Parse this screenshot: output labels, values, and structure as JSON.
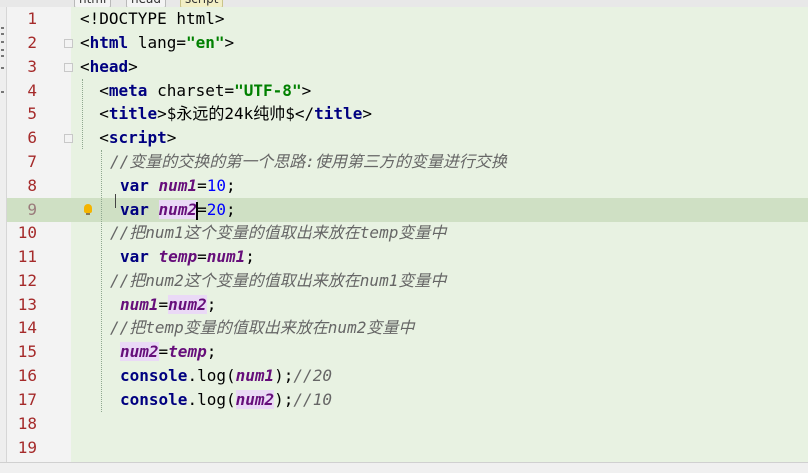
{
  "breadcrumb": [
    "html",
    "head",
    "script"
  ],
  "line_numbers": [
    "1",
    "2",
    "3",
    "4",
    "5",
    "6",
    "7",
    "8",
    "9",
    "10",
    "11",
    "12",
    "13",
    "14",
    "15",
    "16",
    "17",
    "18",
    "19"
  ],
  "current_line": "9",
  "code": {
    "l1": "<!DOCTYPE html>",
    "l2": {
      "open": "<",
      "tag": "html",
      "sp": " ",
      "attr": "lang=",
      "val": "\"en\"",
      "close": ">"
    },
    "l3": {
      "open": "<",
      "tag": "head",
      "close": ">"
    },
    "l4": {
      "indent": "  ",
      "open": "<",
      "tag": "meta",
      "sp": " ",
      "attr": "charset=",
      "val": "\"UTF-8\"",
      "close": ">"
    },
    "l5": {
      "indent": "  ",
      "open": "<",
      "tag": "title",
      "close": ">",
      "text": "$永远的24k纯帅$",
      "open2": "</",
      "tag2": "title",
      "close2": ">"
    },
    "l6": {
      "indent": "  ",
      "open": "<",
      "tag": "script",
      "close": ">"
    },
    "l7": "//变量的交换的第一个思路:使用第三方的变量进行交换",
    "l8": {
      "kw": "var",
      "sp": " ",
      "v": "num1",
      "eq": "=",
      "n": "10",
      "end": ";"
    },
    "l9": {
      "kw": "var",
      "sp": " ",
      "v": "num2",
      "eq": "=",
      "n": "20",
      "end": ";"
    },
    "l10": "//把num1这个变量的值取出来放在temp变量中",
    "l11": {
      "kw": "var",
      "sp": " ",
      "v": "temp",
      "eq": "=",
      "v2": "num1",
      "end": ";"
    },
    "l12": "//把num2这个变量的值取出来放在num1变量中",
    "l13": {
      "v": "num1",
      "eq": "=",
      "v2": "num2",
      "end": ";"
    },
    "l14": "//把temp变量的值取出来放在num2变量中",
    "l15": {
      "v": "num2",
      "eq": "=",
      "v2": "temp",
      "end": ";"
    },
    "l16": {
      "obj": "console",
      "dot": ".",
      "fn": "log",
      "p1": "(",
      "v": "num1",
      "p2": ");",
      "cmt": "//20"
    },
    "l17": {
      "obj": "console",
      "dot": ".",
      "fn": "log",
      "p1": "(",
      "v": "num2",
      "p2": ");",
      "cmt": "//10"
    }
  },
  "colors": {
    "code_bg": "#e8f2e2",
    "current_line_bg": "#cfe0c4",
    "gutter_bg": "#f3f3f3",
    "line_number": "#a52a2a",
    "keyword": "#000080",
    "string": "#008000",
    "variable": "#660e7a",
    "number": "#0000ff",
    "comment": "#666666"
  }
}
